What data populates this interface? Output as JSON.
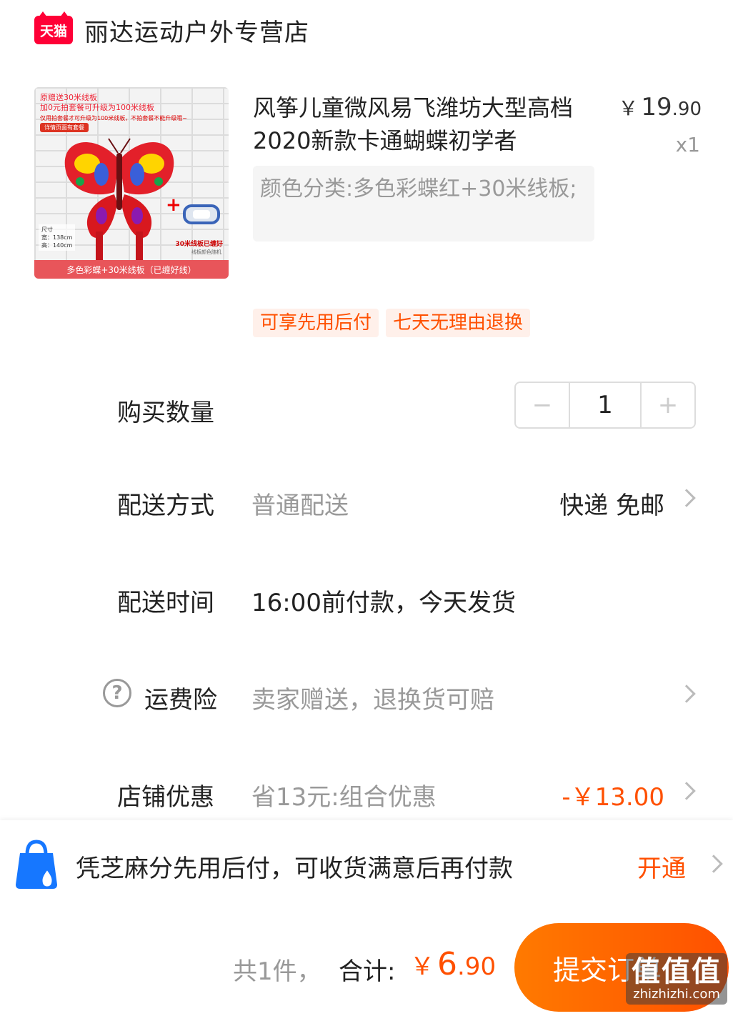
{
  "store": {
    "logo_text": "天猫",
    "name": "丽达运动户外专营店"
  },
  "product": {
    "title": "风筝儿童微风易飞潍坊大型高档2020新款卡通蝴蝶初学者",
    "price_currency": "￥",
    "price_int": "19",
    "price_dec": ".90",
    "quantity_label": "x1",
    "sku": "颜色分类:多色彩蝶红+30米线板;",
    "image": {
      "promo_line1": "原赠送30米线板",
      "promo_line2": "加0元拍套餐可升级为100米线板",
      "promo_small": "仅用拍套餐才可升级为100米线板，不拍套餐不能升级哦~",
      "promo_tag": "详情页面有套餐",
      "size_title": "尺寸",
      "size_w": "宽：138cm",
      "size_h": "高：140cm",
      "plus": "+",
      "spool_text": "30米线板已缠好",
      "spool_sub": "线板颜色随机",
      "bottom_caption": "多色彩蝶+30米线板（已缠好线）"
    }
  },
  "tags": [
    "可享先用后付",
    "七天无理由退换"
  ],
  "rows": {
    "quantity": {
      "label": "购买数量",
      "minus": "−",
      "value": "1",
      "plus": "+"
    },
    "shipping": {
      "label": "配送方式",
      "value": "普通配送",
      "right": "快递 免邮"
    },
    "delivery_time": {
      "label": "配送时间",
      "value": "16:00前付款，今天发货"
    },
    "insurance": {
      "label": "运费险",
      "help": "?",
      "value": "卖家赠送，退换货可赔"
    },
    "discount": {
      "label": "店铺优惠",
      "value": "省13元:组合优惠",
      "amount": "-￥13.00"
    }
  },
  "zhima": {
    "text": "凭芝麻分先用后付，可收货满意后再付款",
    "action": "开通"
  },
  "footer": {
    "count": "共1件，",
    "total_label": "合计:",
    "total_currency": "￥",
    "total_int": "6",
    "total_dec": ".90",
    "submit": "提交订单",
    "watermark_big": "值值值",
    "watermark_small": "zhizhizhi.com"
  },
  "colors": {
    "accent": "#ff5000",
    "tmall_red": "#ff0036",
    "muted": "#999999"
  }
}
